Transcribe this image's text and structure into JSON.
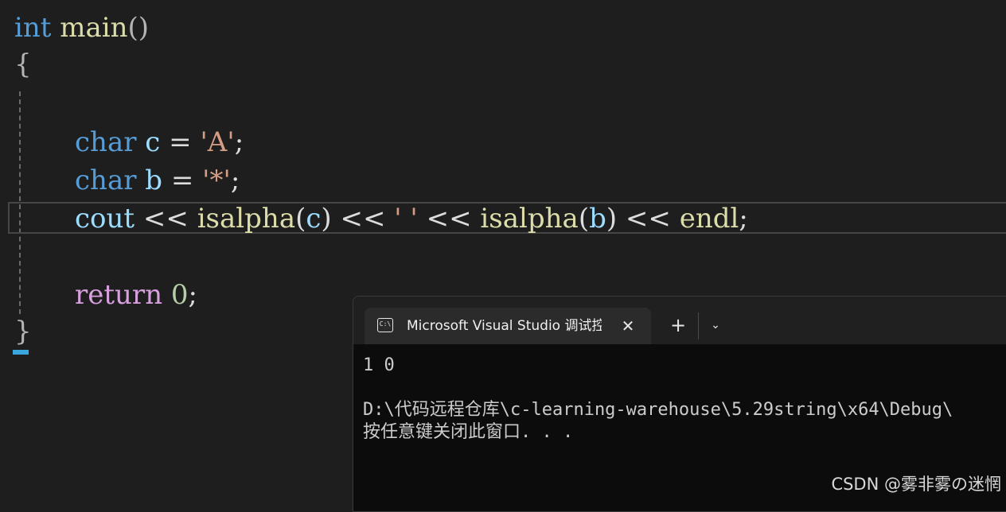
{
  "editor": {
    "lines": [
      {
        "t1": "int",
        "t2": "main",
        "t3": "()"
      },
      {
        "t1": "{"
      },
      {
        "kw": "char",
        "var": "c",
        "op": "=",
        "lit": "'A'",
        "end": ";"
      },
      {
        "kw": "char",
        "var": "b",
        "op": "=",
        "lit": "'*'",
        "end": ";"
      },
      {
        "a": "cout",
        "b": "<<",
        "c": "isalpha",
        "d": "(",
        "e": "c",
        "f": ")",
        "g": "<<",
        "h": "' '",
        "i": "<<",
        "j": "isalpha",
        "k": "(",
        "l": "b",
        "m": ")",
        "n": "<<",
        "o": "endl",
        "p": ";"
      },
      {
        "kw": "return",
        "num": "0",
        "end": ";"
      },
      {
        "t1": "}"
      }
    ]
  },
  "terminal": {
    "tab_title": "Microsoft Visual Studio 调试控",
    "icon_glyph": "C:\\",
    "close_glyph": "✕",
    "new_tab_glyph": "+",
    "dropdown_glyph": "⌄",
    "output": [
      "1 0",
      "",
      "D:\\代码远程仓库\\c-learning-warehouse\\5.29string\\x64\\Debug\\",
      "按任意键关闭此窗口. . ."
    ]
  },
  "watermark": "CSDN @雾非雾の迷惘",
  "colors": {
    "background": "#1e1e1e",
    "keyword": "#569cd6",
    "function": "#dcdcaa",
    "variable": "#9cdcfe",
    "string": "#d69d85",
    "number": "#b5cea8",
    "control": "#d8a0df",
    "terminal_bg": "#0c0c0c"
  }
}
